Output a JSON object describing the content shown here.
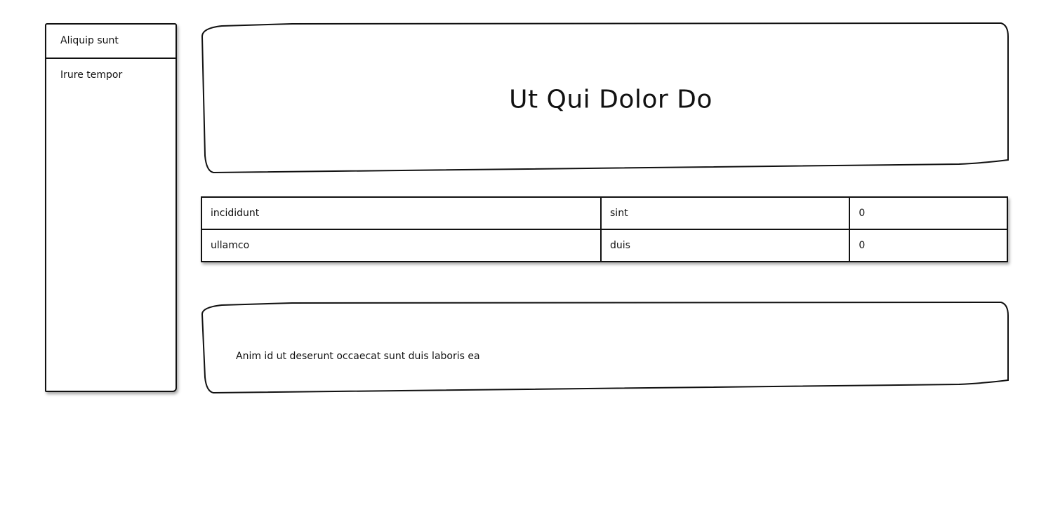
{
  "sidebar": {
    "items": [
      {
        "label": "Aliquip sunt"
      },
      {
        "label": "Irure tempor"
      }
    ]
  },
  "header": {
    "title": "Ut Qui Dolor Do"
  },
  "table": {
    "rows": [
      [
        "incididunt",
        "sint",
        "0"
      ],
      [
        "ullamco",
        "duis",
        "0"
      ]
    ]
  },
  "content": {
    "text": "Anim id ut deserunt occaecat sunt duis laboris ea"
  }
}
